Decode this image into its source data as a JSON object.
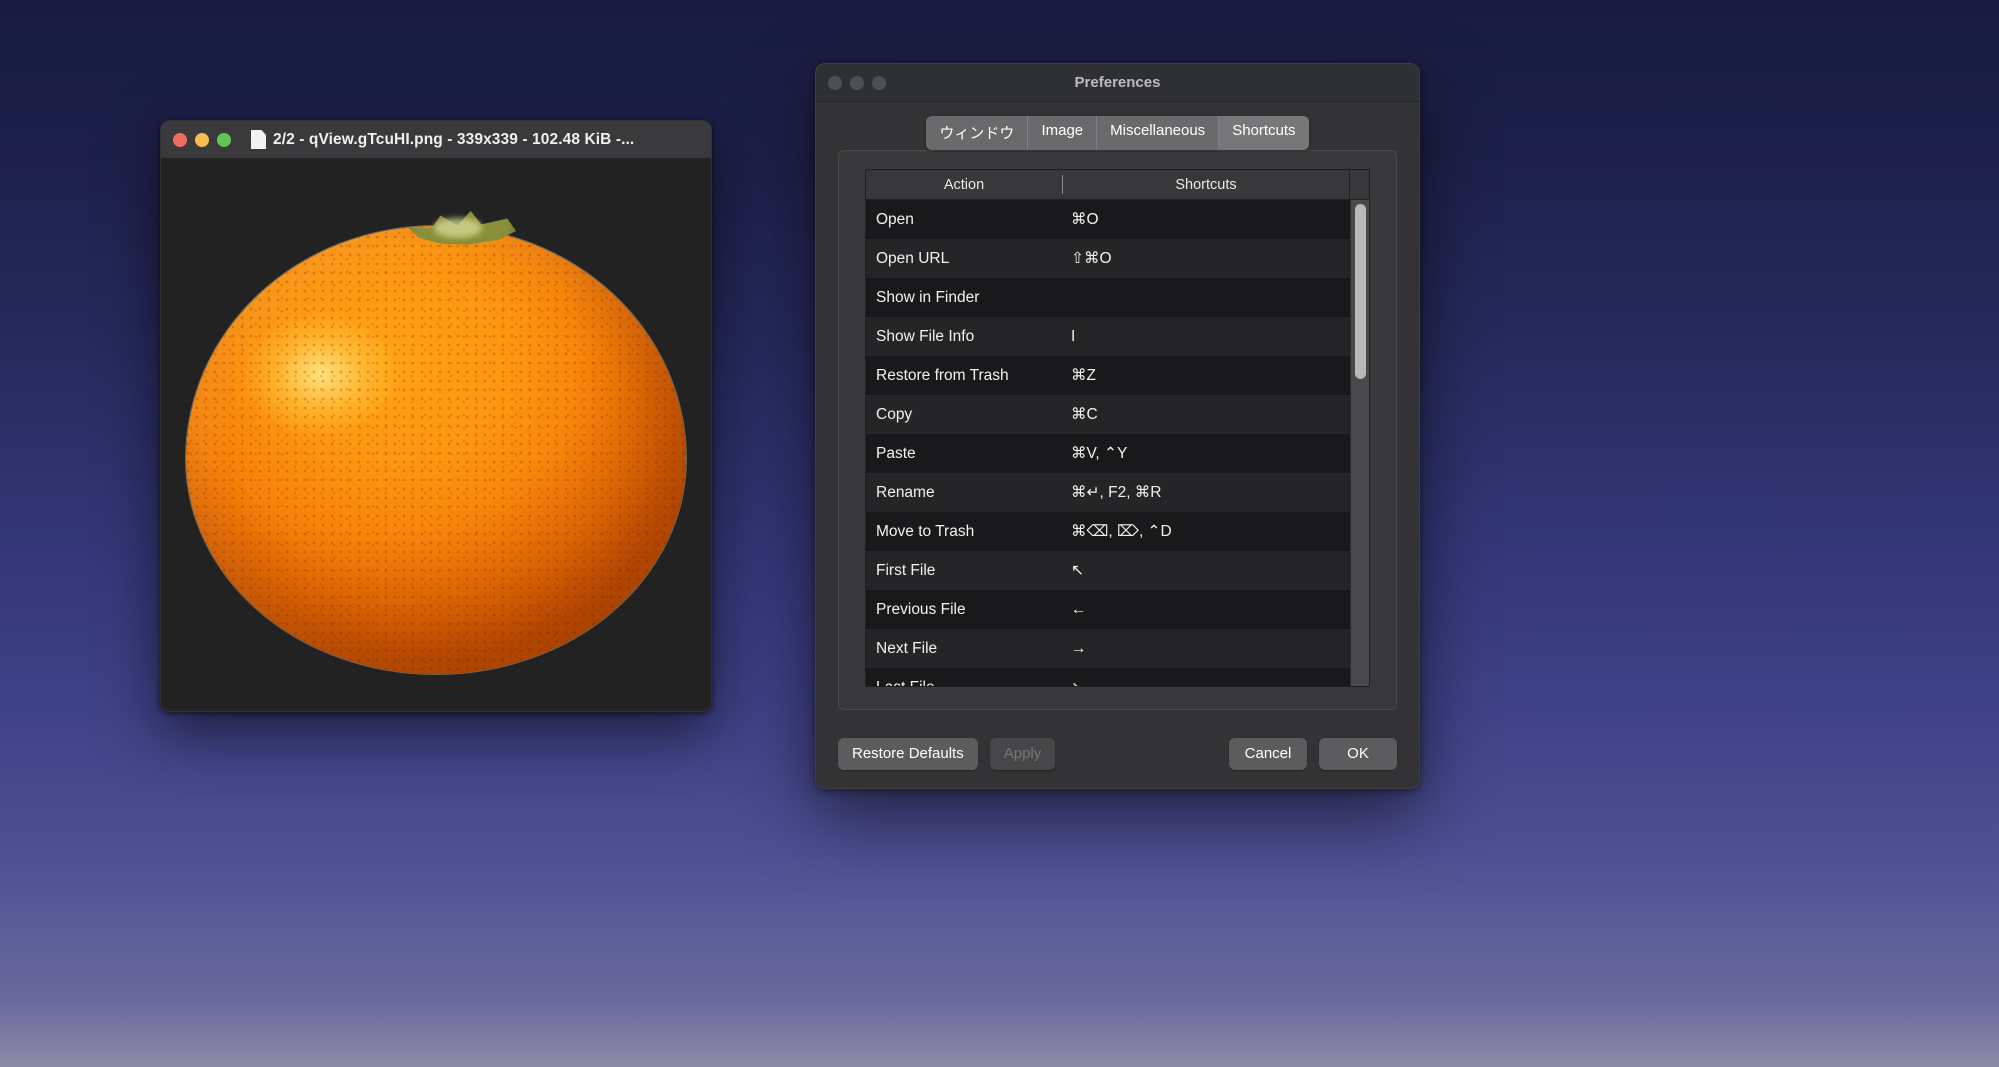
{
  "viewer": {
    "title": "2/2 - qView.gTcuHI.png - 339x339 - 102.48 KiB -...",
    "doc_icon": "document-icon",
    "traffic_lights": [
      "close",
      "minimize",
      "zoom"
    ],
    "image_alt": "orange-fruit"
  },
  "prefs": {
    "title": "Preferences",
    "tabs": [
      {
        "label": "ウィンドウ",
        "selected": false
      },
      {
        "label": "Image",
        "selected": false
      },
      {
        "label": "Miscellaneous",
        "selected": false
      },
      {
        "label": "Shortcuts",
        "selected": true
      }
    ],
    "table": {
      "columns": [
        "Action",
        "Shortcuts"
      ],
      "rows": [
        {
          "action": "Open",
          "shortcut": "⌘O"
        },
        {
          "action": "Open URL",
          "shortcut": "⇧⌘O"
        },
        {
          "action": "Show in Finder",
          "shortcut": ""
        },
        {
          "action": "Show File Info",
          "shortcut": "I"
        },
        {
          "action": "Restore from Trash",
          "shortcut": "⌘Z"
        },
        {
          "action": "Copy",
          "shortcut": "⌘C"
        },
        {
          "action": "Paste",
          "shortcut": "⌘V, ⌃Y"
        },
        {
          "action": "Rename",
          "shortcut": "⌘↵, F2, ⌘R"
        },
        {
          "action": "Move to Trash",
          "shortcut": "⌘⌫, ⌦, ⌃D"
        },
        {
          "action": "First File",
          "shortcut": "↖"
        },
        {
          "action": "Previous File",
          "shortcut": "←"
        },
        {
          "action": "Next File",
          "shortcut": "→"
        },
        {
          "action": "Last File",
          "shortcut": "↘"
        }
      ]
    },
    "buttons": {
      "restore_defaults": "Restore Defaults",
      "apply": "Apply",
      "cancel": "Cancel",
      "ok": "OK"
    }
  },
  "colors": {
    "accent_orange": "#fb9510",
    "traffic_red": "#ed6a5e",
    "traffic_yellow": "#f5bd4f",
    "traffic_green": "#61c555",
    "desktop_top": "#191c40",
    "desktop_bottom": "#8d8aa8"
  }
}
